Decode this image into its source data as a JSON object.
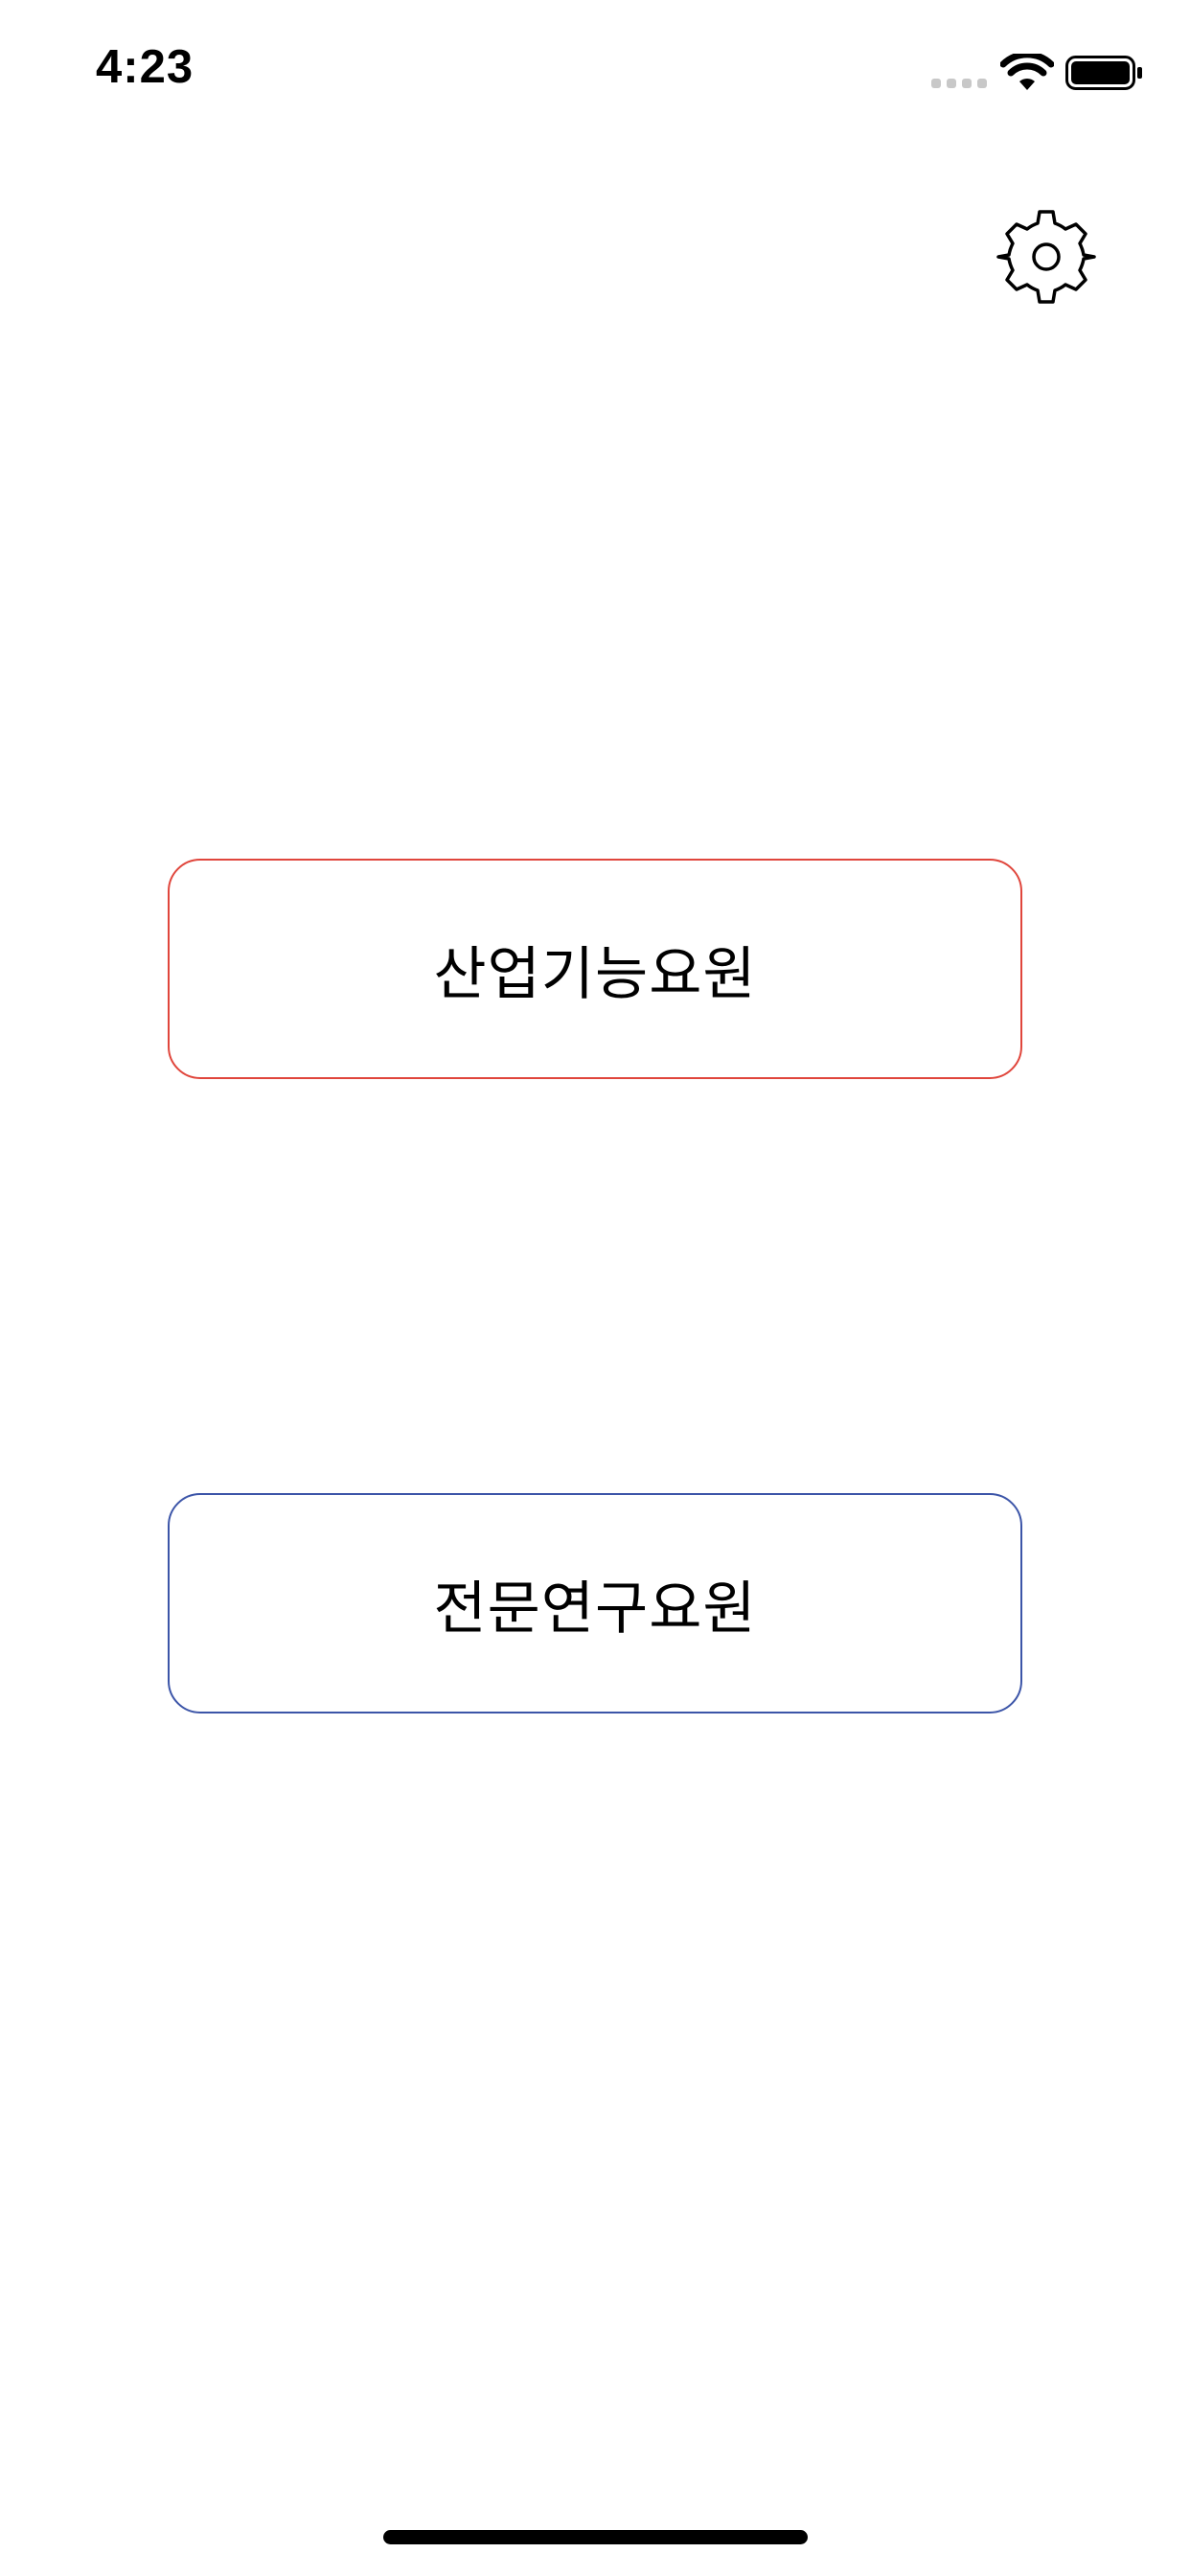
{
  "status_bar": {
    "time": "4:23",
    "icons": [
      "cellular-signal-icon",
      "wifi-icon",
      "battery-icon"
    ]
  },
  "toolbar": {
    "settings_icon": "gear-icon"
  },
  "buttons": {
    "industrial_label": "산업기능요원",
    "research_label": "전문연구요원"
  },
  "colors": {
    "industrial_border": "#e0463c",
    "research_border": "#3c55a8",
    "background": "#ffffff",
    "text": "#000000"
  }
}
